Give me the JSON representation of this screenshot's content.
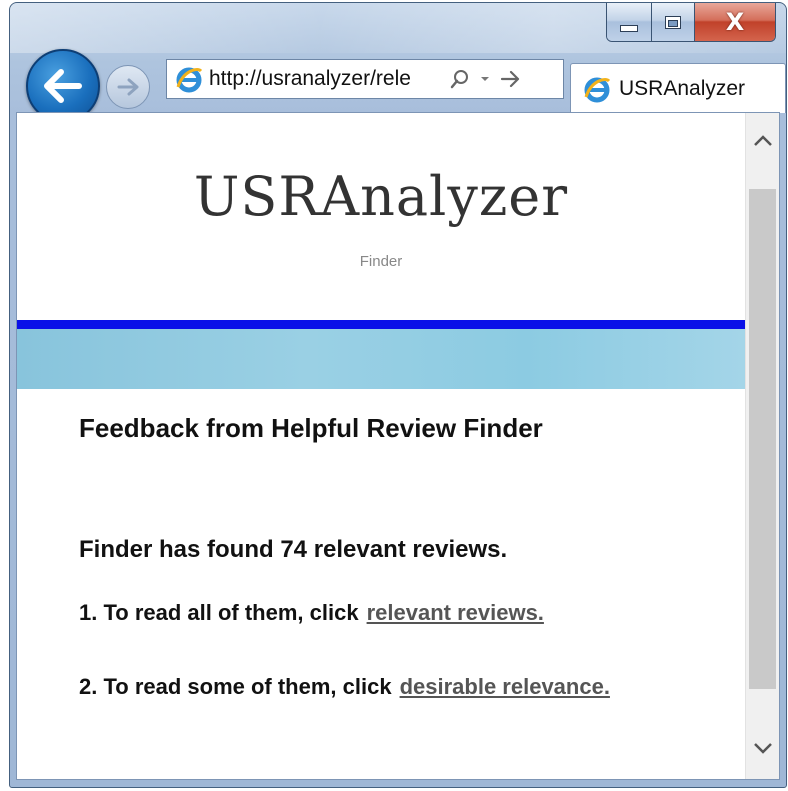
{
  "browser": {
    "address_url": "http://usranalyzer/rele",
    "tab_title": "USRAnalyzer",
    "caption_close_glyph": "X"
  },
  "page": {
    "site_title": "USRAnalyzer",
    "site_subtitle": "Finder",
    "heading": "Feedback from Helpful Review Finder",
    "found_text": "Finder has found 74 relevant reviews.",
    "step1_text": "1. To read all of them, click",
    "step1_link": "relevant reviews.",
    "step2_text": "2. To read some of them, click",
    "step2_link": "desirable relevance."
  },
  "colors": {
    "blue_rule": "#0a10e8",
    "banner": "#9ad0e4",
    "back_button": "#1a6fbd",
    "close_button": "#c0412a"
  },
  "icons": {
    "back": "back-arrow-icon",
    "forward": "forward-arrow-icon",
    "ie_logo": "ie-logo-icon",
    "search": "search-icon",
    "dropdown": "chevron-down-icon",
    "go": "go-arrow-icon",
    "minimize": "minimize-icon",
    "maximize": "maximize-icon",
    "close": "close-icon",
    "scroll_up": "chevron-up-icon",
    "scroll_down": "chevron-down-icon"
  }
}
